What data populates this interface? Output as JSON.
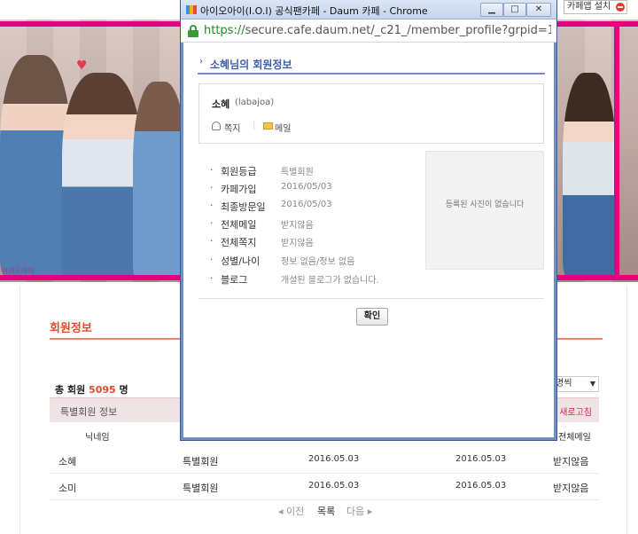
{
  "cafe": {
    "install_label": "카페앱 설치",
    "banner_caption": "아이오아이",
    "section_title": "회원정보",
    "total_prefix": "총 회원",
    "total_count": "5095",
    "total_suffix": "명",
    "per_page": "명씩",
    "grade_label": "특별회원 정보",
    "refresh_label": "새로고침",
    "columns": {
      "nickname": "닉네임",
      "all_mail": "전체메일"
    },
    "rows": [
      {
        "nick": "소혜",
        "grade": "특별회원",
        "join": "2016.05.03",
        "visit": "2016.05.03",
        "mail": "받지않음"
      },
      {
        "nick": "소미",
        "grade": "특별회원",
        "join": "2016.05.03",
        "visit": "2016.05.03",
        "mail": "받지않음"
      }
    ],
    "pager": {
      "prev": "◂ 이전",
      "list": "목록",
      "next": "다음 ▸"
    }
  },
  "popup": {
    "window_title": "아이오아이(I.O.I) 공식팬카페 - Daum 카페 - Chrome",
    "url_scheme": "https://",
    "url_rest": "secure.cafe.daum.net/_c21_/member_profile?grpid=1\\",
    "section_header": "소혜님의 회원정보",
    "nickname": "소혜",
    "user_id": "(labajoa)",
    "note_label": "쪽지",
    "sep": "|",
    "mail_label": "메일",
    "info": [
      {
        "label": "회원등급",
        "value": "특별회원"
      },
      {
        "label": "카페가입",
        "value": "2016/05/03"
      },
      {
        "label": "최종방문일",
        "value": "2016/05/03"
      },
      {
        "label": "전체메일",
        "value": "받지않음"
      },
      {
        "label": "전체쪽지",
        "value": "받지않음"
      },
      {
        "label": "성별/나이",
        "value": "정보 없음/정보 없음"
      },
      {
        "label": "블로그",
        "value": "개설된 블로그가 없습니다."
      }
    ],
    "photo_text": "등록된 사진이 없습니다",
    "ok_label": "확인",
    "win_min": "▁",
    "win_max": "□",
    "win_close": "✕"
  },
  "icons": [
    "favicon-icon",
    "lock-icon",
    "note-icon",
    "mail-icon",
    "remove-icon",
    "dropdown-arrow-icon",
    "heart-icon"
  ]
}
